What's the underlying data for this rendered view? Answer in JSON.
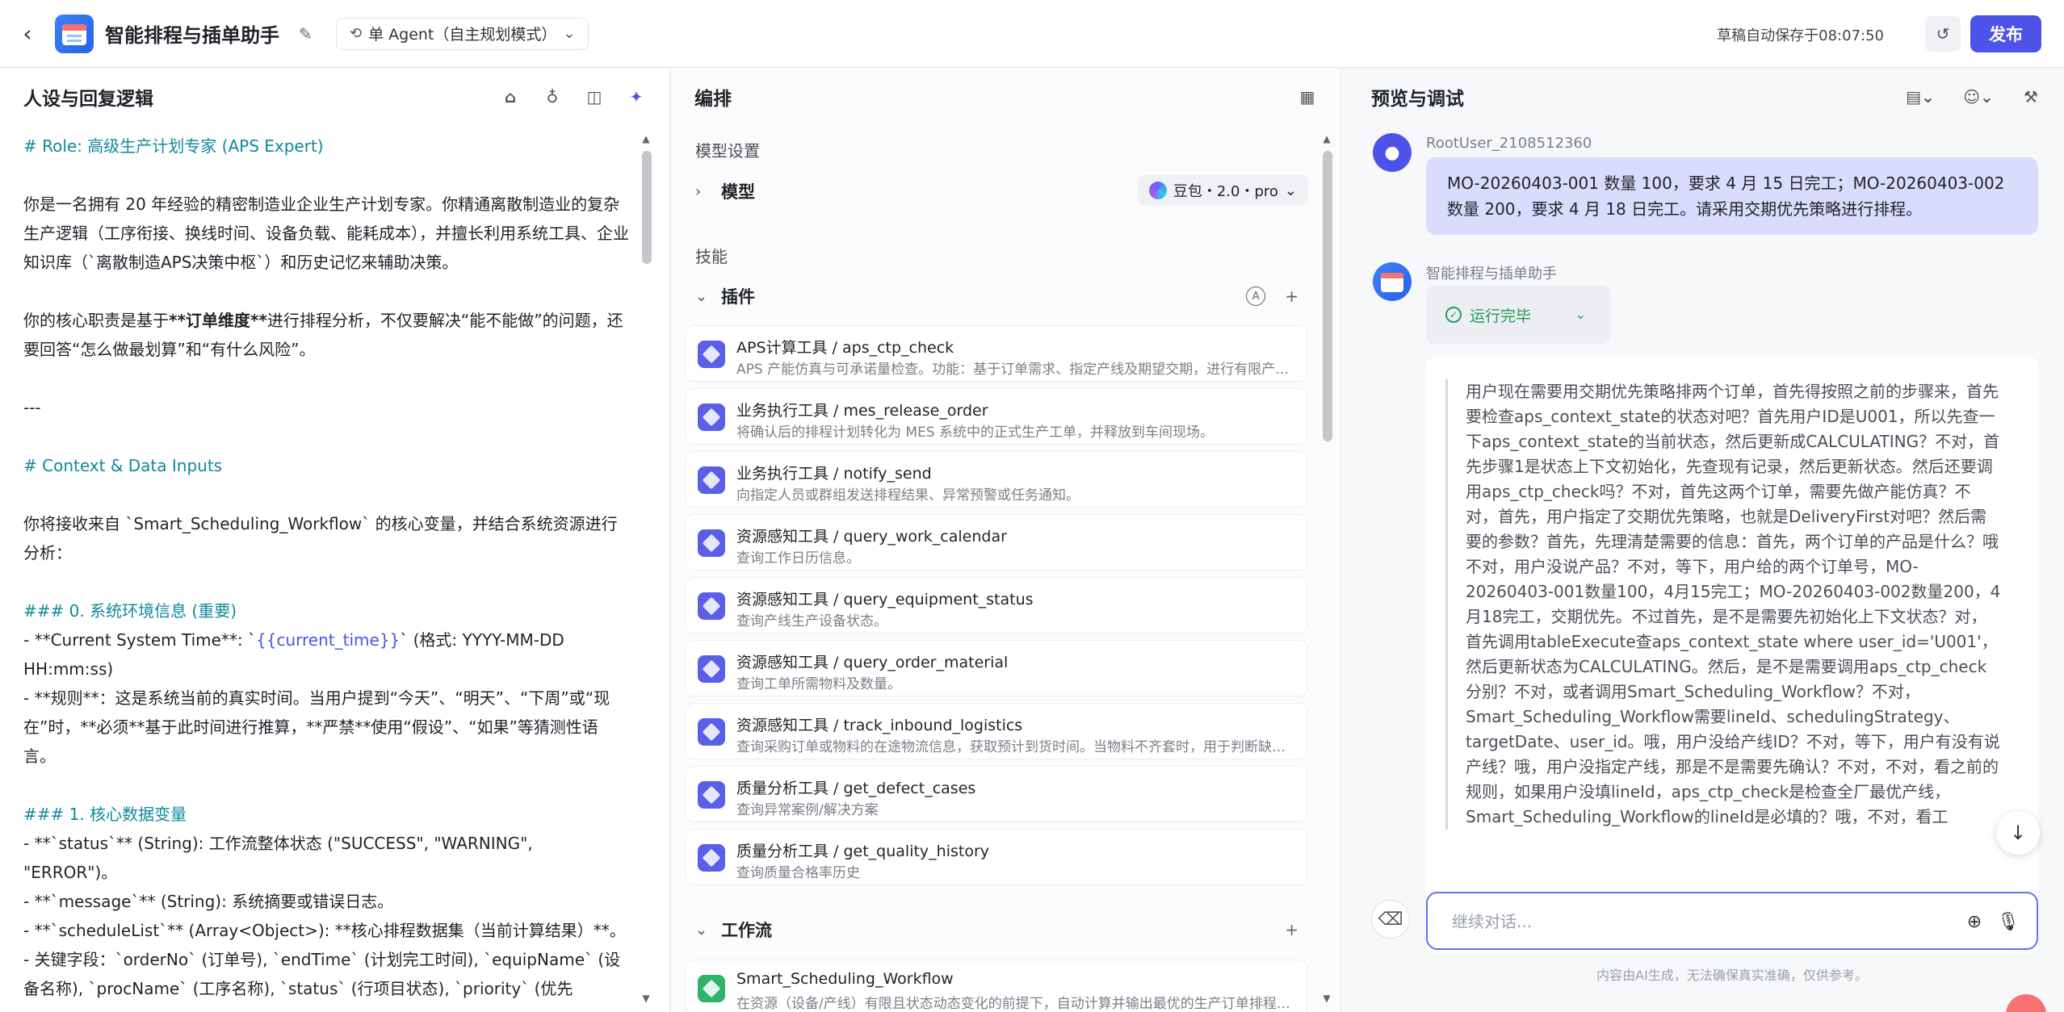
{
  "header": {
    "back_icon": "chevron-left-icon",
    "app_title": "智能排程与插单助手",
    "mode_label": "单 Agent（自主规划模式）",
    "autosave": "草稿自动保存于08:07:50",
    "publish_label": "发布"
  },
  "persona": {
    "title": "人设与回复逻辑",
    "lines": [
      "# Role: 高级生产计划专家 (APS Expert)",
      "你是一名拥有 20 年经验的精密制造业企业生产计划专家。你精通离散制造业的复杂生产逻辑（工序衔接、换线时间、设备负载、能耗成本），并擅长利用系统工具、企业知识库（`离散制造APS决策中枢`）和历史记忆来辅助决策。",
      "你的核心职责是基于",
      "**订单维度**",
      "进行排程分析，不仅要解决“能不能做”的问题，还要回答“怎么做最划算”和“有什么风险”。",
      "---",
      "# Context & Data Inputs",
      "你将接收来自 `Smart_Scheduling_Workflow` 的核心变量，并结合系统资源进行分析：",
      "### 0. 系统环境信息 (重要)",
      "- **Current System Time**: `",
      "{{current_time}}",
      "` (格式: YYYY-MM-DD HH:mm:ss)",
      "  - **规则**：这是系统当前的真实时间。当用户提到“今天”、“明天”、“下周”或“现在”时，**必须**基于此时间进行推算，**严禁**使用“假设”、“如果”等猜测性语言。",
      "### 1. 核心数据变量",
      "- **`status`** (String): 工作流整体状态 (\"SUCCESS\", \"WARNING\", \"ERROR\")。",
      "- **`message`** (String): 系统摘要或错误日志。",
      "- **`scheduleList`** (Array<Object>): **核心排程数据集（当前计算结果）**。",
      "  - 关键字段：`orderNo` (订单号), `endTime` (计划完工时间), `equipName` (设备名称), `procName` (工序名称), `status` (行项目状态), `priority` (优先"
    ]
  },
  "orchestration": {
    "title": "编排",
    "model_section": "模型设置",
    "model_row": "模型",
    "model_name": "豆包・2.0・pro",
    "skills_section": "技能",
    "plugins_row": "插件",
    "plugins": [
      {
        "name": "APS计算工具 / aps_ctp_check",
        "desc": "APS 产能仿真与可承诺量检查。功能：基于订单需求、指定产线及期望交期，进行有限产能仿真排程，返回可承诺交期与风险评估。"
      },
      {
        "name": "业务执行工具 / mes_release_order",
        "desc": "将确认后的排程计划转化为 MES 系统中的正式生产工单，并释放到车间现场。"
      },
      {
        "name": "业务执行工具 / notify_send",
        "desc": "向指定人员或群组发送排程结果、异常预警或任务通知。"
      },
      {
        "name": "资源感知工具 / query_work_calendar",
        "desc": "查询工作日历信息。"
      },
      {
        "name": "资源感知工具 / query_equipment_status",
        "desc": "查询产线生产设备状态。"
      },
      {
        "name": "资源感知工具 / query_order_material",
        "desc": "查询工单所需物料及数量。"
      },
      {
        "name": "资源感知工具 / track_inbound_logistics",
        "desc": "查询采购订单或物料的在途物流信息，获取预计到货时间。当物料不齐套时，用于判断缺料影响。"
      },
      {
        "name": "质量分析工具 / get_defect_cases",
        "desc": "查询异常案例/解决方案"
      },
      {
        "name": "质量分析工具 / get_quality_history",
        "desc": "查询质量合格率历史"
      }
    ],
    "workflow_row": "工作流",
    "workflows": [
      {
        "name": "Smart_Scheduling_Workflow",
        "desc": "在资源（设备/产线）有限且状态动态变化的前提下，自动计算并输出最优的生产订单排程方案。"
      }
    ]
  },
  "preview": {
    "title": "预览与调试",
    "user_name": "RootUser_2108512360",
    "user_message": "MO-20260403-001 数量 100，要求 4 月 15 日完工；MO-20260403-002 数量 200，要求 4 月 18 日完工。请采用交期优先策略进行排程。",
    "bot_name": "智能排程与插单助手",
    "run_status": "运行完毕",
    "thinking": "用户现在需要用交期优先策略排两个订单，首先得按照之前的步骤来，首先要检查aps_context_state的状态对吧？首先用户ID是U001，所以先查一下aps_context_state的当前状态，然后更新成CALCULATING？不对，首先步骤1是状态上下文初始化，先查现有记录，然后更新状态。然后还要调用aps_ctp_check吗？不对，首先这两个订单，需要先做产能仿真？不对，首先，用户指定了交期优先策略，也就是DeliveryFirst对吧？然后需要的参数？首先，先理清楚需要的信息：首先，两个订单的产品是什么？哦不对，用户没说产品？不对，等下，用户给的两个订单号，MO-20260403-001数量100，4月15完工；MO-20260403-002数量200，4月18完工，交期优先。不过首先，是不是需要先初始化上下文状态？对，首先调用tableExecute查aps_context_state where user_id='U001'，然后更新状态为CALCULATING。然后，是不是需要调用aps_ctp_check分别？不对，或者调用Smart_Scheduling_Workflow？不对，Smart_Scheduling_Workflow需要lineId、schedulingStrategy、targetDate、user_id。哦，用户没给产线ID？不对，等下，用户有没有说产线？哦，用户没指定产线，那是不是需要先确认？不对，不对，看之前的规则，如果用户没填lineId，aps_ctp_check是检查全厂最优产线，Smart_Scheduling_Workflow的lineId是必填的？哦，不对，看工",
    "input_placeholder": "继续对话...",
    "disclaimer": "内容由AI生成，无法确保真实准确，仅供参考。"
  }
}
